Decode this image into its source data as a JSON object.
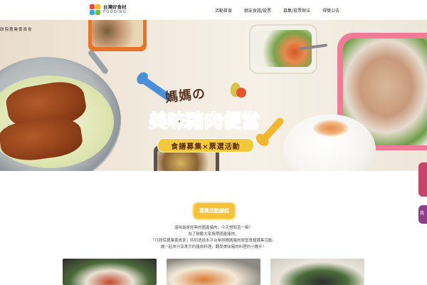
{
  "header": {
    "logo_cn": "台灣好食材",
    "logo_en": "FOODING",
    "nav": [
      {
        "label": "活動首頁"
      },
      {
        "label": "網友食譜/投票"
      },
      {
        "label": "募集/投票辦法"
      },
      {
        "label": "得獎公告"
      }
    ]
  },
  "hero": {
    "council": "政院農業委員會",
    "title_top": "媽媽の",
    "title_main_a": "美味",
    "title_main_b": "豬肉便當",
    "subtitle": "食譜募集×票選活動"
  },
  "side": {
    "tab_b_label": "我"
  },
  "section": {
    "badge": "募集活動緣起",
    "lines": [
      "滷味最是經典的國產豬肉，今天想知道一嘛？",
      "為了鼓勵大家攜帶國產豬肉，",
      "「行政院農業委員會」特別透過本平台舉辦媽媽豬肉便當食譜募集活動，",
      "讓一起來分享拿手的豬肉料理，翻學美味豬肉料理的小撇步！"
    ]
  },
  "colors": {
    "accent": "#f5c23a",
    "title_brown": "#7a3d1e",
    "title_orange": "#e75a1e",
    "side_pink": "#c6446b",
    "side_purple": "#8a3f86"
  }
}
